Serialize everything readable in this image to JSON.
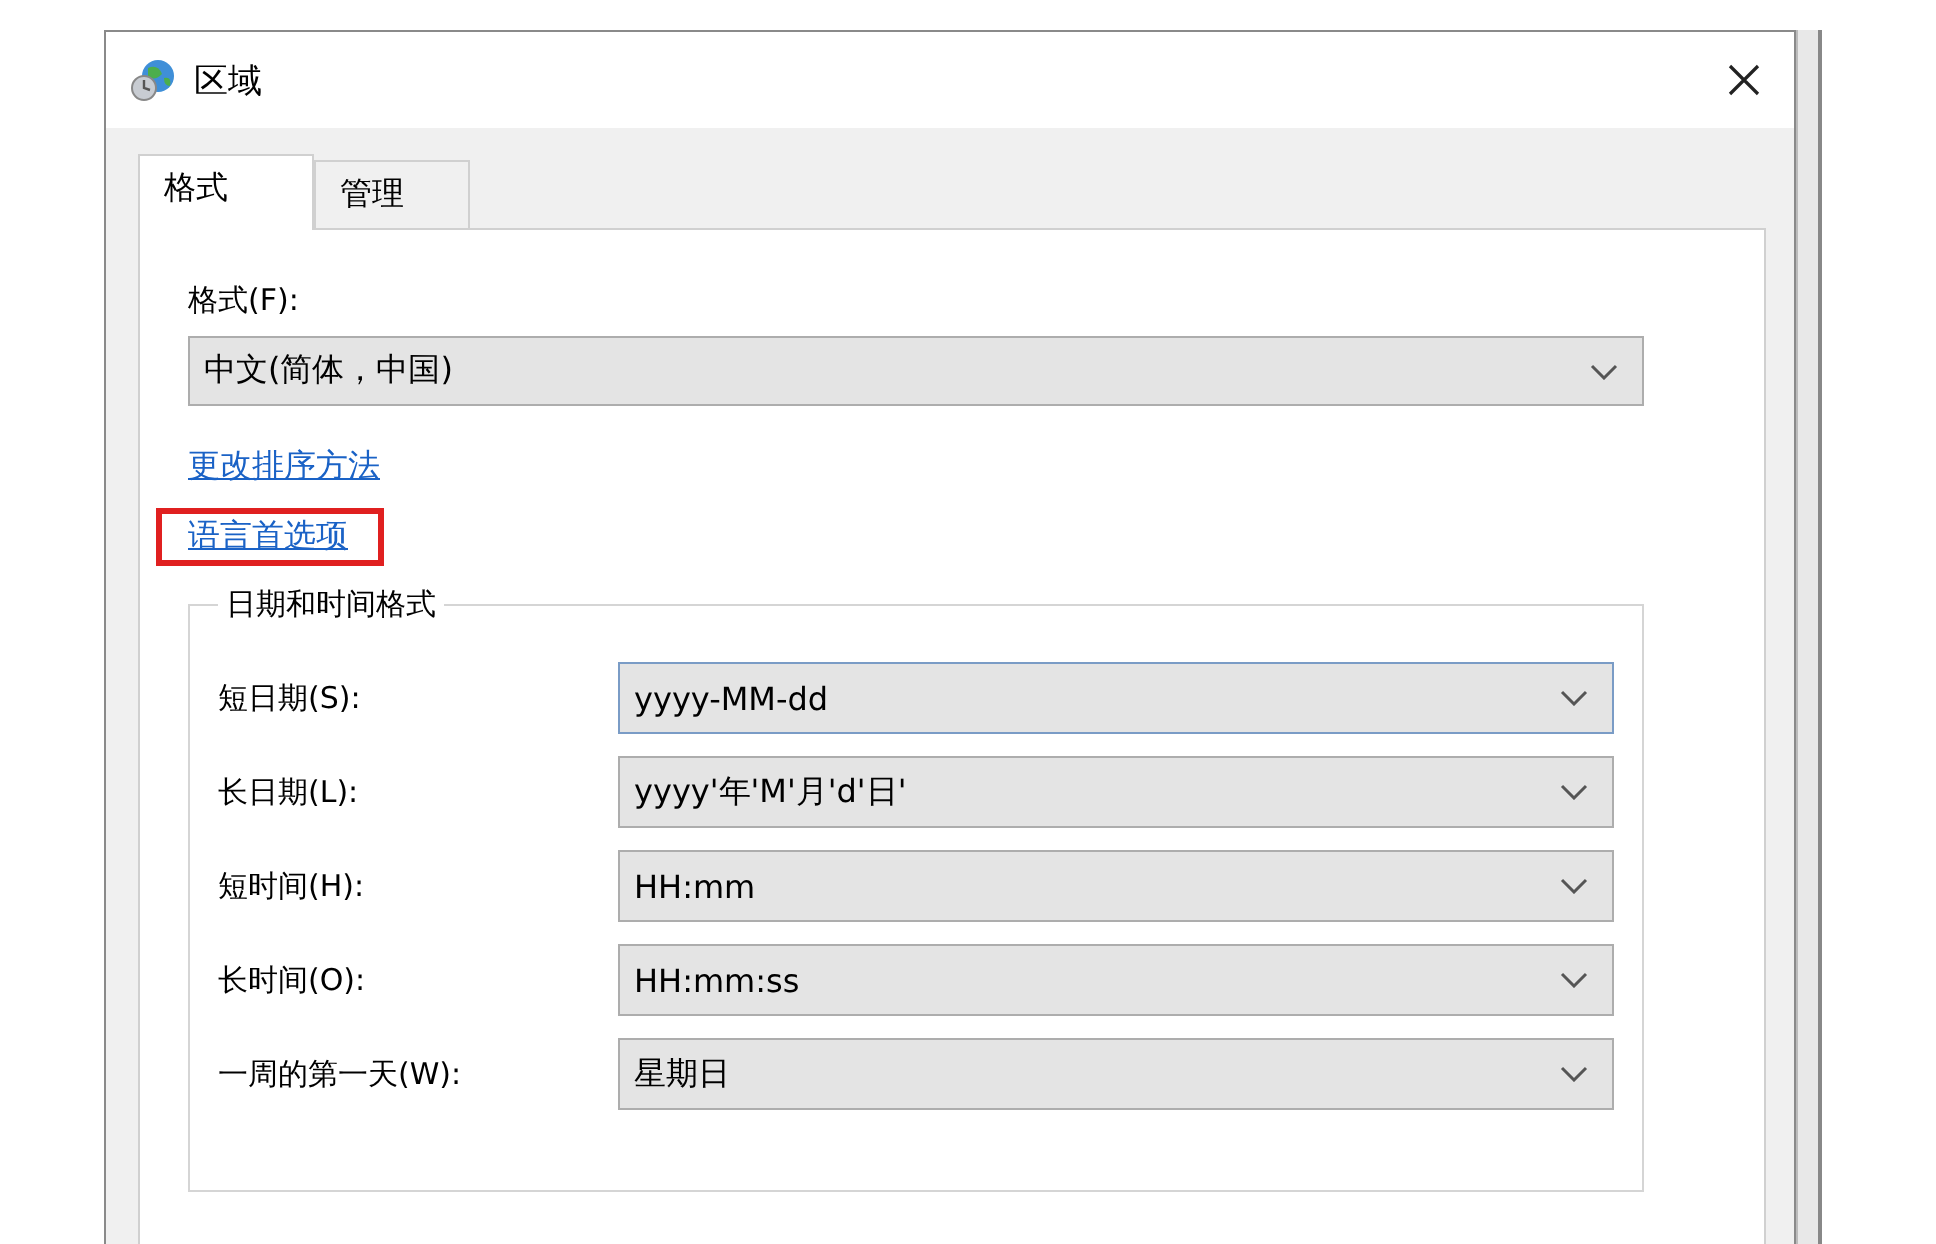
{
  "window": {
    "title": "区域"
  },
  "tabs": [
    {
      "label": "格式",
      "selected": true
    },
    {
      "label": "管理",
      "selected": false
    }
  ],
  "format": {
    "label": "格式(F):",
    "value": "中文(简体，中国)"
  },
  "links": [
    {
      "label": "更改排序方法",
      "highlighted": false
    },
    {
      "label": "语言首选项",
      "highlighted": true
    }
  ],
  "date_time_group": {
    "title": "日期和时间格式",
    "rows": [
      {
        "label": "短日期(S):",
        "value": "yyyy-MM-dd",
        "focused": true
      },
      {
        "label": "长日期(L):",
        "value": "yyyy'年'M'月'd'日'",
        "focused": false
      },
      {
        "label": "短时间(H):",
        "value": "HH:mm",
        "focused": false
      },
      {
        "label": "长时间(O):",
        "value": "HH:mm:ss",
        "focused": false
      },
      {
        "label": "一周的第一天(W):",
        "value": "星期日",
        "focused": false
      }
    ]
  }
}
